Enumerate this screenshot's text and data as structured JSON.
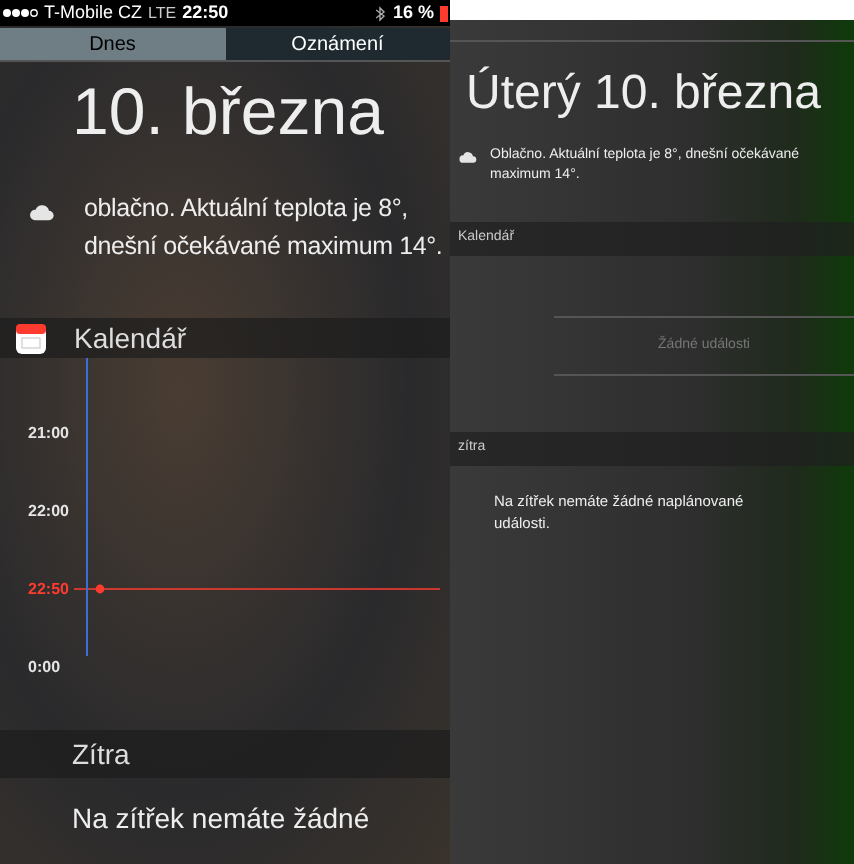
{
  "status_bar": {
    "carrier": "T-Mobile CZ",
    "network": "LTE",
    "time": "22:50",
    "battery": "16 %"
  },
  "phone": {
    "tabs": [
      {
        "label": "Dnes",
        "selected": true
      },
      {
        "label": "Oznámení",
        "selected": false
      }
    ],
    "date": "10. března",
    "weather": "oblačno. Aktuální teplota je 8°, dnešní očekávané maximum 14°.",
    "calendar": {
      "title": "Kalendář",
      "hours": [
        {
          "label": "21:00",
          "kind": "hour"
        },
        {
          "label": "22:00",
          "kind": "hour"
        },
        {
          "label": "22:50",
          "kind": "now"
        },
        {
          "label": "0:00",
          "kind": "hour"
        }
      ]
    },
    "tomorrow": {
      "title": "Zítra",
      "message": "Na zítřek nemáte žádné"
    }
  },
  "desktop": {
    "date": "Úterý 10. března",
    "weather": "Oblačno. Aktuální teplota je 8°, dnešní očekávané maximum 14°.",
    "calendar": {
      "title": "Kalendář",
      "empty": "Žádné události"
    },
    "tomorrow": {
      "title": "zítra",
      "message": "Na zítřek nemáte žádné naplánované události."
    }
  }
}
